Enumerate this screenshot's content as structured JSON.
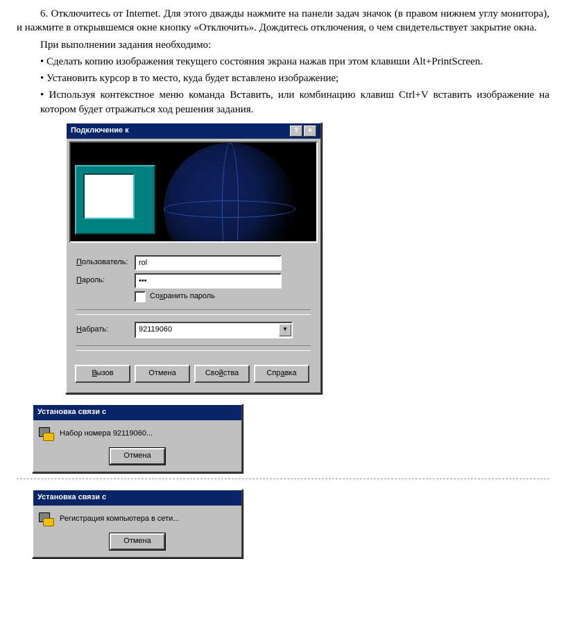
{
  "text": {
    "p1": "6. Отключитесь от Internet. Для этого дважды нажмите на панели задач значок (в правом нижнем углу монитора), и нажмите в открывшемся окне кнопку «Отключить». Дождитесь отключения, о чем свидетельствует закрытие окна.",
    "p2": "При выполнении задания необходимо:",
    "b1": "Сделать копию изображения текущего состояния экрана нажав при этом клавиши Alt+PrintScreen.",
    "b2": "Установить курсор в то место, куда будет вставлено изображение;",
    "b3": "Используя контекстное меню команда Вставить, или комбинацию клавиш Ctrl+V вставить изображение на котором будет отражаться ход решения задания."
  },
  "dialog1": {
    "title": "Подключение к",
    "help": "?",
    "close": "×",
    "labels": {
      "user": "Пользователь:",
      "pass": "Пароль:",
      "save": "Сохранить пароль",
      "dial": "Набрать:"
    },
    "values": {
      "user": "rol",
      "pass": "•••",
      "dial": "92119060"
    },
    "buttons": {
      "call": "Вызов",
      "cancel": "Отмена",
      "props": "Свойства",
      "help": "Справка"
    }
  },
  "dialog2": {
    "title": "Установка связи с",
    "msg": "Набор номера 92119060...",
    "cancel": "Отмена"
  },
  "dialog3": {
    "title": "Установка связи с",
    "msg": "Регистрация компьютера в сети...",
    "cancel": "Отмена"
  }
}
